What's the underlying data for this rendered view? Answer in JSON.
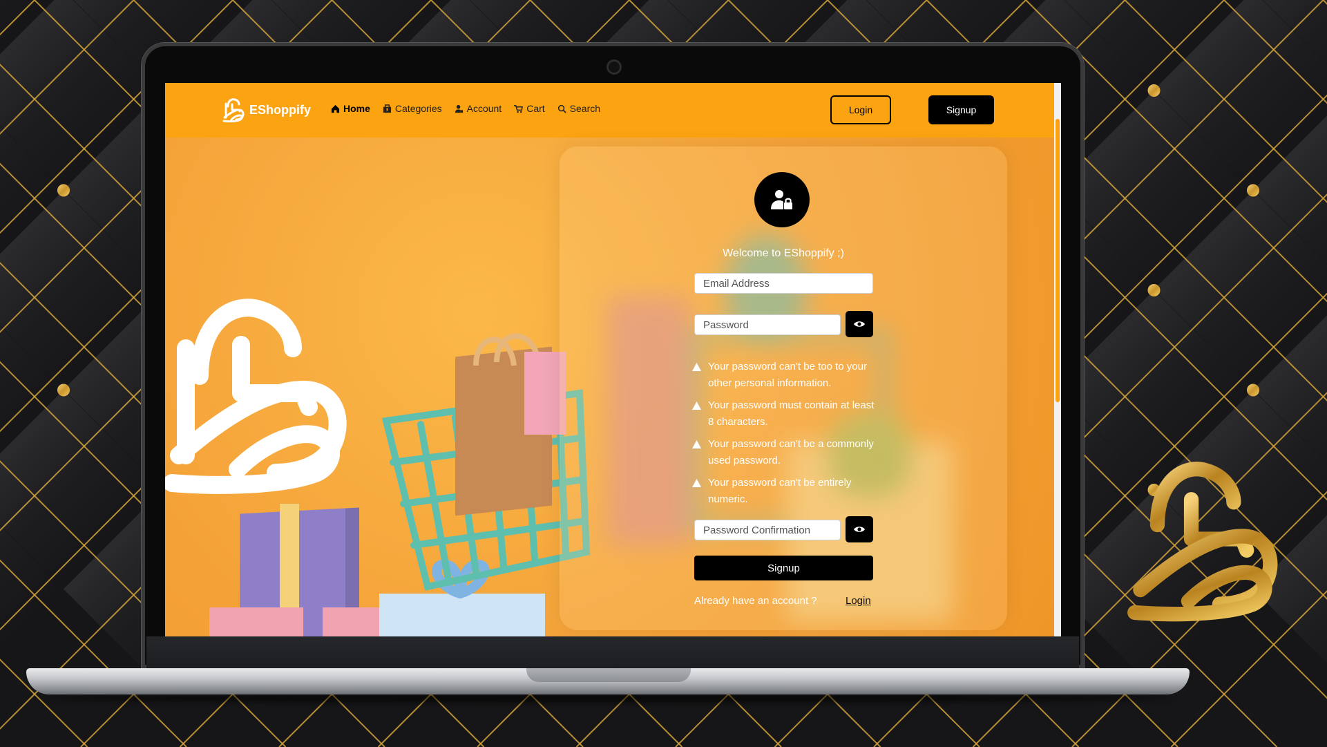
{
  "brand": {
    "name": "EShoppify",
    "icon": "shopping-bag-logo-icon"
  },
  "nav": {
    "items": [
      {
        "label": "Home",
        "icon": "home-icon",
        "active": true
      },
      {
        "label": "Categories",
        "icon": "category-box-icon",
        "active": false
      },
      {
        "label": "Account",
        "icon": "user-icon",
        "active": false
      },
      {
        "label": "Cart",
        "icon": "cart-icon",
        "active": false
      },
      {
        "label": "Search",
        "icon": "search-icon",
        "active": false
      }
    ],
    "login_label": "Login",
    "signup_label": "Signup"
  },
  "form": {
    "welcome": "Welcome to EShoppify ;)",
    "email_placeholder": "Email Address",
    "password_placeholder": "Password",
    "password_confirm_placeholder": "Password Confirmation",
    "password_rules": [
      "Your password can't be too to your other personal information.",
      "Your password must contain at least 8 characters.",
      "Your password can't be a commonly used password.",
      "Your password can't be entirely numeric."
    ],
    "signup_label": "Signup",
    "already_text": "Already have an account ?",
    "login_link": "Login"
  },
  "colors": {
    "accent": "#fca311",
    "black": "#000000",
    "white": "#ffffff",
    "gold": "#d4a43a"
  }
}
